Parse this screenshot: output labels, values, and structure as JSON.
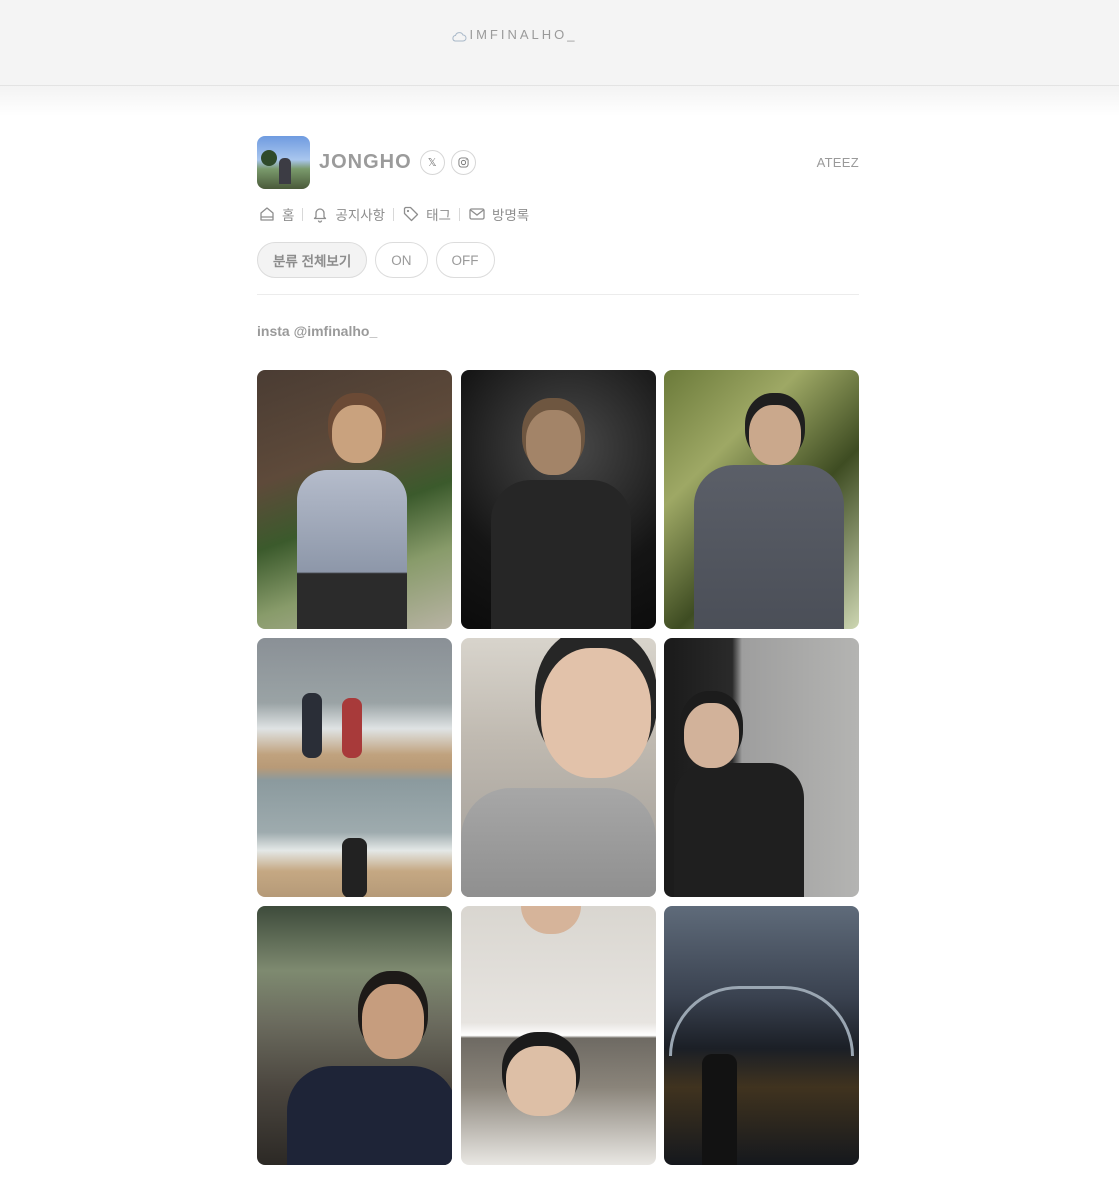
{
  "site": {
    "title": "IMFINALHO_",
    "cloud_icon": "cloud-icon"
  },
  "profile": {
    "name": "JONGHO",
    "group": "ATEEZ",
    "social": [
      {
        "icon": "x-twitter-icon",
        "glyph": "𝕏"
      },
      {
        "icon": "instagram-icon",
        "glyph": "◎"
      }
    ]
  },
  "nav": {
    "items": [
      {
        "label": "홈",
        "icon": "home-icon"
      },
      {
        "label": "공지사항",
        "icon": "bell-icon"
      },
      {
        "label": "태그",
        "icon": "tag-icon"
      },
      {
        "label": "방명록",
        "icon": "mail-icon"
      }
    ]
  },
  "filters": {
    "items": [
      {
        "label": "분류 전체보기",
        "active": true
      },
      {
        "label": "ON",
        "active": false
      },
      {
        "label": "OFF",
        "active": false
      }
    ]
  },
  "post": {
    "caption": "insta @imfinalho_"
  },
  "colors": {
    "accent": "#9a9a9a",
    "background": "#ffffff",
    "topbar": "#f4f4f4"
  }
}
